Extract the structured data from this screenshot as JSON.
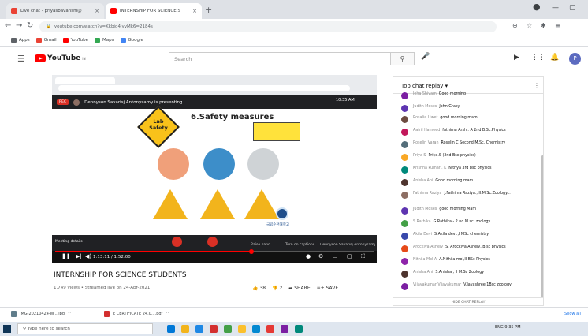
{
  "browser": {
    "tabs": [
      {
        "title": "Live chat - priyasbavanshi@ |",
        "color": "#1a73e8"
      },
      {
        "title": "INTERNSHIP FOR SCIENCE S",
        "color": "#ff0000"
      }
    ],
    "new_tab": "+",
    "url": "youtube.com/watch?v=Kkbjg4iyvMk6=2184s",
    "profile_initial": "P",
    "bookmarks": [
      {
        "label": "Apps",
        "color": "#5f6368"
      },
      {
        "label": "Gmail",
        "color": "#ea4335"
      },
      {
        "label": "YouTube",
        "color": "#ff0000"
      },
      {
        "label": "Maps",
        "color": "#34a853"
      },
      {
        "label": "Google",
        "color": "#4285f4"
      }
    ]
  },
  "youtube": {
    "logo": "YouTube",
    "logo_sup": "IN",
    "search_placeholder": "Search",
    "avatar_initial": "P"
  },
  "video": {
    "meet_banner": "Dennyson Savarisj Antonysamy is presenting",
    "rec_label": "REC",
    "meet_time": "10:35 AM",
    "slide_title": "6.Safety measures",
    "lab_label": "Lab Safety",
    "school_label": "국립순천대학교",
    "time": "1:13:11 / 1:52:00",
    "meeting_details": "Meeting details",
    "ctrl_labels": [
      "Raise hand",
      "Turn on captions",
      "Dennyson Savarisj Antonysamy is presenting"
    ]
  },
  "below_video": {
    "title": "INTERNSHIP FOR SCIENCE STUDENTS",
    "meta": "1,749 views • Streamed live on 24-Apr-2021",
    "likes": "38",
    "dislikes": "2",
    "share": "SHARE",
    "save": "SAVE",
    "more": "..."
  },
  "chat": {
    "header": "Top chat replay",
    "hide": "HIDE CHAT REPLAY",
    "messages": [
      {
        "author": "Jeha Shiyam",
        "text": "Good morning",
        "color": "#7b1fa2"
      },
      {
        "author": "Judith Moses",
        "text": "John Gracy",
        "color": "#5e35b1"
      },
      {
        "author": "Rosalia Liwet",
        "text": "good morning mam",
        "color": "#6d4c41"
      },
      {
        "author": "Aafril Hameed",
        "text": "fathima Arshi. A 2nd B.Sc.Physics",
        "color": "#c2185b"
      },
      {
        "author": "Roselin Varan",
        "text": "Roselin C Second M.Sc. Chemistry",
        "color": "#546e7a"
      },
      {
        "author": "Priya S",
        "text": "Priya.S (2nd Bsc physics)",
        "color": "#f9a825"
      },
      {
        "author": "Krishna kumari. K",
        "text": "Nithya 3rd bsc physics",
        "color": "#00897b"
      },
      {
        "author": "Anisha Ani",
        "text": "Good morning mam.",
        "color": "#4e342e"
      },
      {
        "author": "Fathima Raziya",
        "text": "J.Fathima Raziya., II.M.Sc.Zoology...",
        "color": "#8d6e63"
      },
      {
        "author": "Judith Moses",
        "text": "good morning Mam",
        "color": "#5e35b1"
      },
      {
        "author": "S Rathika",
        "text": "G.Rathika - 2 nd M.sc. zoology",
        "color": "#43a047"
      },
      {
        "author": "Akila Devi",
        "text": "S.Akila devi.,I MSc chemistry",
        "color": "#3949ab"
      },
      {
        "author": "Arockiya Ashely",
        "text": "S. Arockiya Ashely, B.sc physics",
        "color": "#e64a19"
      },
      {
        "author": "Nithila Mol A",
        "text": "A.Nithila mol,II BSc Physics",
        "color": "#8e24aa"
      },
      {
        "author": "Anisha Ani",
        "text": "S.Anisha , II M.Sc Zoology",
        "color": "#4e342e"
      },
      {
        "author": "Vijayakumar Vijayakumar",
        "text": "V.Jayashree 1Bsc zoology",
        "color": "#7b1fa2"
      }
    ]
  },
  "downloads": [
    {
      "name": "IMG-20210424-W....jpg",
      "color": "#607d8b"
    },
    {
      "name": "E CERTIFICATE 24.0....pdf",
      "color": "#d32f2f"
    }
  ],
  "show_all": "Show all",
  "taskbar": {
    "search": "Type here to search",
    "system": "ENG  9:35 PM",
    "icons": [
      "#0078d7",
      "#f2b41c",
      "#1e88e5",
      "#d32f2f",
      "#43a047",
      "#fbc02d",
      "#0288d1",
      "#e53935",
      "#7b1fa2",
      "#00897b"
    ]
  }
}
